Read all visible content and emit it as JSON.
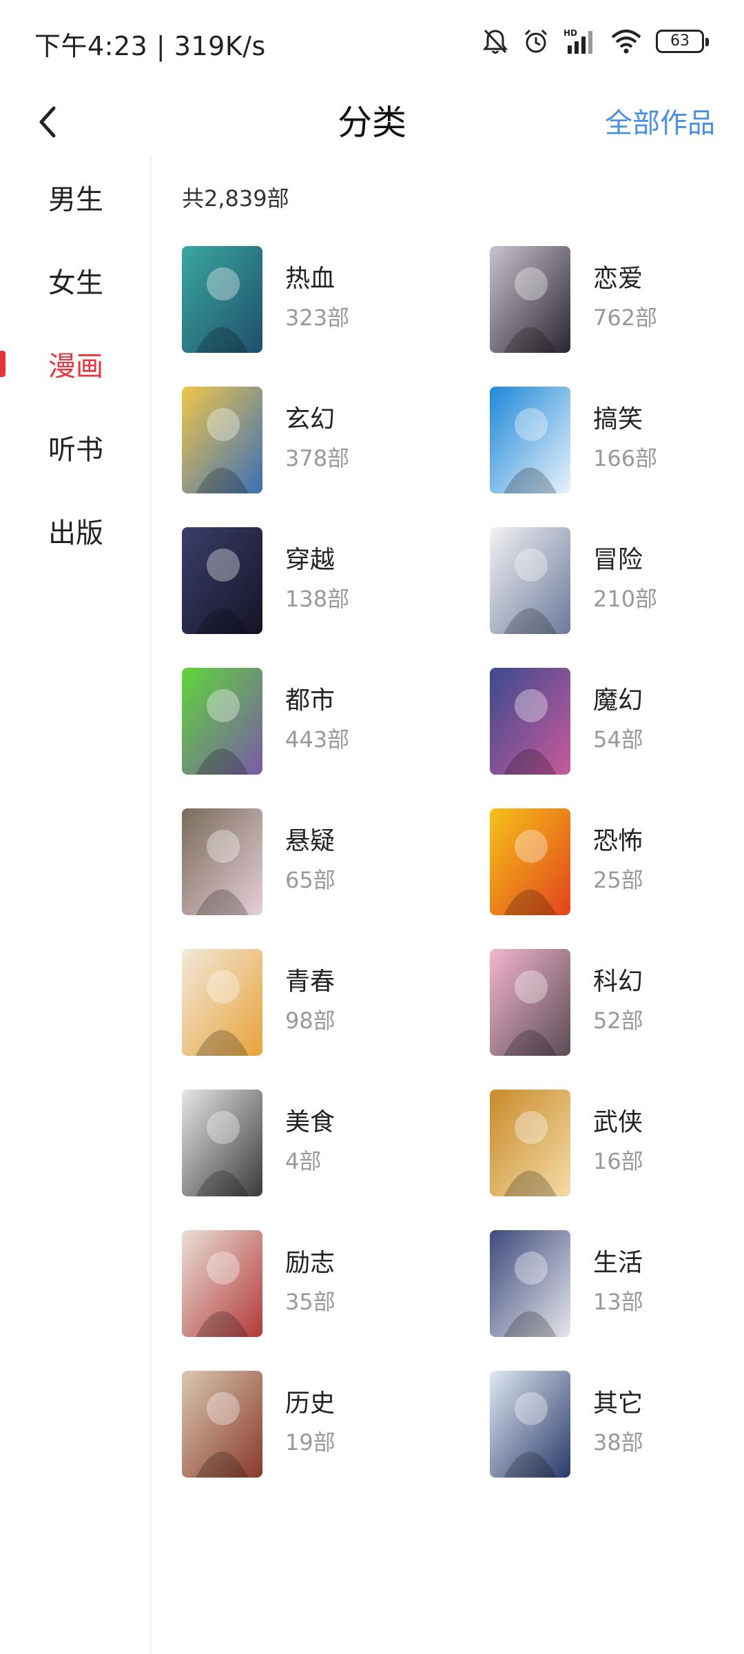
{
  "status_bar": {
    "time": "下午4:23 | 319K/s",
    "signal_label": "HD",
    "battery": "63",
    "icons": [
      "mute-bell-icon",
      "alarm-icon",
      "signal-icon",
      "wifi-icon",
      "battery-icon"
    ]
  },
  "header": {
    "title": "分类",
    "right_link": "全部作品",
    "back_icon": "back-arrow-icon"
  },
  "sidebar": {
    "items": [
      {
        "label": "男生",
        "active": false
      },
      {
        "label": "女生",
        "active": false
      },
      {
        "label": "漫画",
        "active": true
      },
      {
        "label": "听书",
        "active": false
      },
      {
        "label": "出版",
        "active": false
      }
    ]
  },
  "content": {
    "total": "共2,839部",
    "categories": [
      {
        "name": "热血",
        "count": "323部"
      },
      {
        "name": "恋爱",
        "count": "762部"
      },
      {
        "name": "玄幻",
        "count": "378部"
      },
      {
        "name": "搞笑",
        "count": "166部"
      },
      {
        "name": "穿越",
        "count": "138部"
      },
      {
        "name": "冒险",
        "count": "210部"
      },
      {
        "name": "都市",
        "count": "443部"
      },
      {
        "name": "魔幻",
        "count": "54部"
      },
      {
        "name": "悬疑",
        "count": "65部"
      },
      {
        "name": "恐怖",
        "count": "25部"
      },
      {
        "name": "青春",
        "count": "98部"
      },
      {
        "name": "科幻",
        "count": "52部"
      },
      {
        "name": "美食",
        "count": "4部"
      },
      {
        "name": "武侠",
        "count": "16部"
      },
      {
        "name": "励志",
        "count": "35部"
      },
      {
        "name": "生活",
        "count": "13部"
      },
      {
        "name": "历史",
        "count": "19部"
      },
      {
        "name": "其它",
        "count": "38部"
      }
    ]
  },
  "colors": {
    "accent_red": "#e8343a",
    "link_blue": "#4a90e2",
    "muted_text": "#999999",
    "covers": [
      [
        "#3aa7a0",
        "#1f4f6b"
      ],
      [
        "#c9c3cf",
        "#2b2530"
      ],
      [
        "#f0c64a",
        "#3a6fb8"
      ],
      [
        "#1e88d8",
        "#e8f2fb"
      ],
      [
        "#3b3f6a",
        "#141326"
      ],
      [
        "#f2f2f4",
        "#6b7a9a"
      ],
      [
        "#5fd63a",
        "#7a5aa8"
      ],
      [
        "#3a4a8f",
        "#c85a9a"
      ],
      [
        "#7a6b5a",
        "#e6cfd8"
      ],
      [
        "#f6c21a",
        "#e2441c"
      ],
      [
        "#f2e8da",
        "#e7a33a"
      ],
      [
        "#f4b6cf",
        "#5a4b55"
      ],
      [
        "#e6e6e6",
        "#3a3a3a"
      ],
      [
        "#c98a2a",
        "#f3dca6"
      ],
      [
        "#e9e0d6",
        "#b33a3a"
      ],
      [
        "#3d4a7c",
        "#e5e5ea"
      ],
      [
        "#d9c8b0",
        "#8a3a2a"
      ],
      [
        "#dfe8f2",
        "#2a3a6a"
      ]
    ]
  }
}
